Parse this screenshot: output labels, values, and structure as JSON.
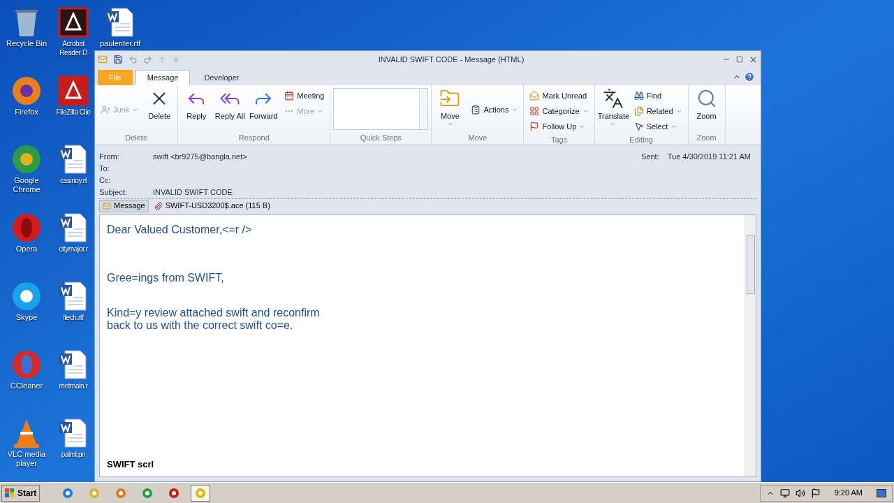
{
  "desktop": {
    "columns": [
      [
        {
          "label": "Recycle Bin"
        },
        {
          "label": "Firefox"
        },
        {
          "label": "Google Chrome"
        },
        {
          "label": "Opera"
        },
        {
          "label": "Skype"
        },
        {
          "label": "CCleaner"
        },
        {
          "label": "VLC media player"
        }
      ],
      [
        {
          "label": "Acrobat Reader D"
        },
        {
          "label": "FileZilla Clie"
        },
        {
          "label": "casinoy.rt"
        },
        {
          "label": "citymajor.r"
        },
        {
          "label": "ltech.rtf"
        },
        {
          "label": "metmain.r"
        },
        {
          "label": "palml.pn"
        }
      ],
      [
        {
          "label": "paulenter.rtf"
        }
      ]
    ]
  },
  "window": {
    "title": "INVALID SWIFT CODE - Message (HTML)",
    "tabs": [
      {
        "label": "File",
        "kind": "file",
        "selected": false
      },
      {
        "label": "Message",
        "kind": "tab",
        "selected": true
      },
      {
        "label": "Developer",
        "kind": "tab",
        "selected": false
      }
    ],
    "ribbon": [
      {
        "name": "Delete",
        "items": [
          {
            "kind": "small",
            "label": "Junk",
            "disabled": true,
            "dropdown": true
          },
          {
            "kind": "large",
            "label": "Delete",
            "disabled": false,
            "dropdown": false
          }
        ]
      },
      {
        "name": "Respond",
        "items": [
          {
            "kind": "large",
            "label": "Reply",
            "disabled": false,
            "dropdown": false
          },
          {
            "kind": "large",
            "label": "Reply All",
            "disabled": false,
            "dropdown": false
          },
          {
            "kind": "large",
            "label": "Forward",
            "disabled": false,
            "dropdown": false
          },
          {
            "kind": "stack",
            "children": [
              {
                "label": "Meeting",
                "disabled": false,
                "dropdown": false
              },
              {
                "label": "More",
                "disabled": true,
                "dropdown": true
              }
            ]
          }
        ]
      },
      {
        "name": "Quick Steps",
        "items": [
          {
            "kind": "gallery"
          }
        ]
      },
      {
        "name": "Move",
        "items": [
          {
            "kind": "large",
            "label": "Move",
            "disabled": false,
            "dropdown": true
          },
          {
            "kind": "small",
            "label": "Actions",
            "disabled": false,
            "dropdown": true
          }
        ]
      },
      {
        "name": "Tags",
        "items": [
          {
            "kind": "stack",
            "children": [
              {
                "label": "Mark Unread",
                "disabled": false,
                "dropdown": false
              },
              {
                "label": "Categorize",
                "disabled": false,
                "dropdown": true
              },
              {
                "label": "Follow Up",
                "disabled": false,
                "dropdown": true
              }
            ]
          }
        ]
      },
      {
        "name": "Editing",
        "items": [
          {
            "kind": "large",
            "label": "Translate",
            "disabled": false,
            "dropdown": true
          },
          {
            "kind": "stack",
            "children": [
              {
                "label": "Find",
                "disabled": false,
                "dropdown": false
              },
              {
                "label": "Related",
                "disabled": false,
                "dropdown": true
              },
              {
                "label": "Select",
                "disabled": false,
                "dropdown": true
              }
            ]
          }
        ]
      },
      {
        "name": "Zoom",
        "items": [
          {
            "kind": "large",
            "label": "Zoom",
            "disabled": false,
            "dropdown": false
          }
        ]
      }
    ],
    "header": {
      "fields": [
        {
          "label": "From:",
          "value": "swift <br9275@bangla.net>"
        },
        {
          "label": "To:"
        },
        {
          "label": "Cc:"
        },
        {
          "label": "Subject:",
          "value": "INVALID SWIFT CODE"
        }
      ],
      "sent_label": "Sent:",
      "sent_value": "Tue 4/30/2019 11:21 AM"
    },
    "attachments": [
      {
        "label": "Message",
        "kind": "message",
        "selected": true
      },
      {
        "label": "SWIFT-USD3200$.ace (115 B)",
        "kind": "file",
        "selected": false
      }
    ],
    "body": {
      "paragraphs": [
        [
          "Dear Valued Customer,<=r />"
        ],
        [
          "Gree=ings from SWIFT,"
        ],
        [
          "Kind=y review attached swift and reconfirm",
          "back to us with the correct swift co=e."
        ]
      ],
      "signature": "SWIFT scrl"
    }
  },
  "taskbar": {
    "start": "Start",
    "time": "9:20 AM",
    "apps": [
      {
        "selected": false
      },
      {
        "selected": false
      },
      {
        "selected": false
      },
      {
        "selected": false
      },
      {
        "selected": false
      },
      {
        "selected": true
      }
    ]
  }
}
